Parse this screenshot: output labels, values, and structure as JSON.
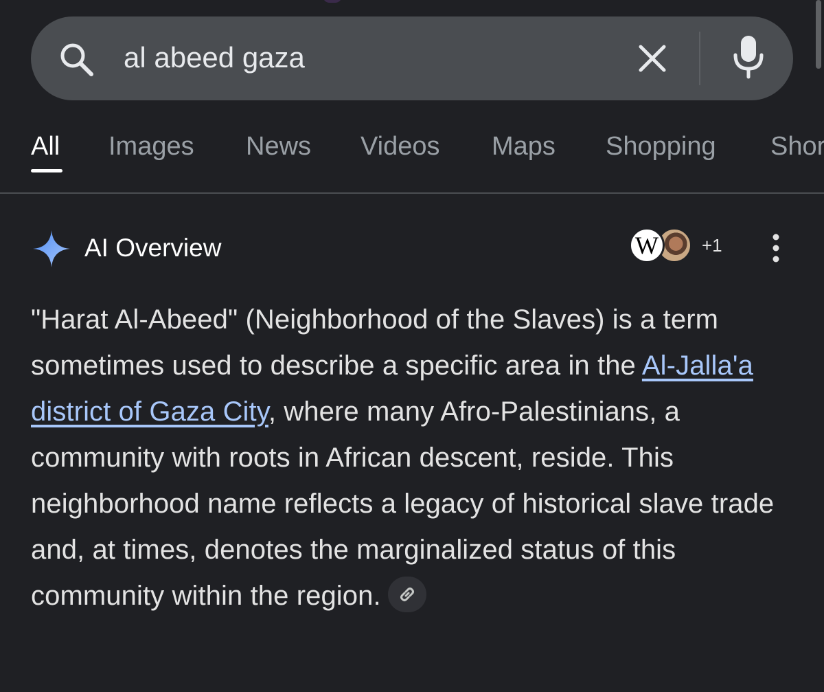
{
  "search": {
    "query": "al abeed gaza",
    "placeholder": ""
  },
  "tabs": [
    {
      "label": "All",
      "active": true
    },
    {
      "label": "Images",
      "active": false
    },
    {
      "label": "News",
      "active": false
    },
    {
      "label": "Videos",
      "active": false
    },
    {
      "label": "Maps",
      "active": false
    },
    {
      "label": "Shopping",
      "active": false
    },
    {
      "label": "Shor",
      "active": false
    }
  ],
  "ai_overview": {
    "title": "AI Overview",
    "sources": {
      "wiki_letter": "W",
      "more_count": "+1"
    },
    "paragraph": {
      "before_link": "\"Harat Al-Abeed\" (Neighborhood of the Slaves) is a term sometimes used to describe a specific area in the ",
      "link_text": "Al-Jalla'a district of Gaza City",
      "after_link": ", where many Afro-Palestinians, a community with roots in African descent, reside. This neighborhood name reflects a legacy of historical slave trade and, at times, denotes the marginalized status of this community within the region."
    }
  },
  "colors": {
    "background": "#1f2024",
    "searchbar": "#4a4d51",
    "link": "#a8c7fa",
    "sparkle": "#8ab4f8"
  },
  "icons": {
    "search": "search-icon",
    "clear": "close-icon",
    "mic": "microphone-icon",
    "sparkle": "sparkle-icon",
    "menu": "more-vert-icon",
    "link": "link-icon"
  }
}
